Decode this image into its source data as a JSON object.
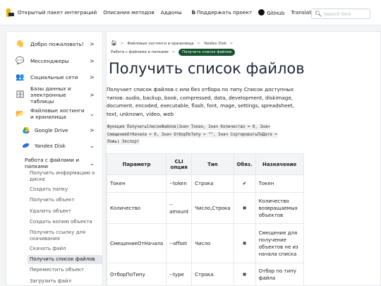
{
  "topbar": {
    "brand_text": "Открытый пакет интеграций",
    "methods": "Описания методов",
    "addons": "Аддоны",
    "support": "Поддержать проект",
    "github": "GitHub",
    "translation": "Translation",
    "search_placeholder": "Search OInt"
  },
  "sidebar": {
    "items": [
      {
        "label": "Добро пожаловать!",
        "icon": "waving-hand-icon",
        "chevron": ">"
      },
      {
        "label": "Мессенджеры",
        "icon": "chat-icon",
        "chevron": ">"
      },
      {
        "label": "Социальные сети",
        "icon": "people-icon",
        "chevron": ">"
      },
      {
        "label": "Базы данных и электронные таблицы",
        "icon": "database-icon",
        "chevron": ">"
      },
      {
        "label": "Файловые хостинги и хранилища",
        "icon": "folder-icon",
        "chevron": "v"
      },
      {
        "label": "Google Drive",
        "icon": "google-drive-icon",
        "chevron": ">"
      },
      {
        "label": "Yandex Disk",
        "icon": "yandex-disk-icon",
        "chevron": "v"
      },
      {
        "label": "Работа с файлами и папками",
        "icon": "",
        "chevron": "v"
      }
    ],
    "subitems": [
      "Получить информацию о диске",
      "Создать папку",
      "Получить объект",
      "Удалить объект",
      "Создать копию объекта",
      "Получить ссылку для скачивания",
      "Скачать файл",
      "Получить список файлов",
      "Переместить объект",
      "Загрузить файл"
    ],
    "active_subitem": "Получить список файлов"
  },
  "breadcrumb": {
    "level1": "Файловые хостинги и хранилища",
    "level2": "Yandex Disk",
    "level3": "Работа с файлами и папками",
    "current": "Получить список файлов"
  },
  "page": {
    "title": "Получить список файлов",
    "description": "Получает список файлов с или без отбора по типу Список доступных типов: audio, backup, book, compressed, data, development, diskimage, document, encoded, executable, flash, font, mage, settings, spreadsheet, text, unknown, video, web",
    "signature_line1": "Функция ПолучитьСписокФайлов(Знач Токен, Знач Количество = 0, Знач",
    "signature_line2": "СмещениеОтНачала = 0, Знач ОтборПоТипу = \"\", Знач СортироватьПоДате =",
    "signature_line3": "Ложь) Экспорт"
  },
  "params_table": {
    "headers": [
      "Параметр",
      "CLI опция",
      "Тип",
      "Обяз.",
      "Назначение"
    ],
    "rows": [
      [
        "Токен",
        "--token",
        "Строка",
        "✔",
        "Токен"
      ],
      [
        "Количество",
        "-- amount",
        "Число,Строка",
        "✖",
        "Количество возвращаемых объектов"
      ],
      [
        "СмещениеОтНачала",
        "--offset",
        "Число",
        "✖",
        "Смещение для получение объектов не из начала списка"
      ],
      [
        "ОтборПоТипу",
        "--type",
        "Строка",
        "✖",
        "Отбор по типу файла"
      ]
    ]
  }
}
